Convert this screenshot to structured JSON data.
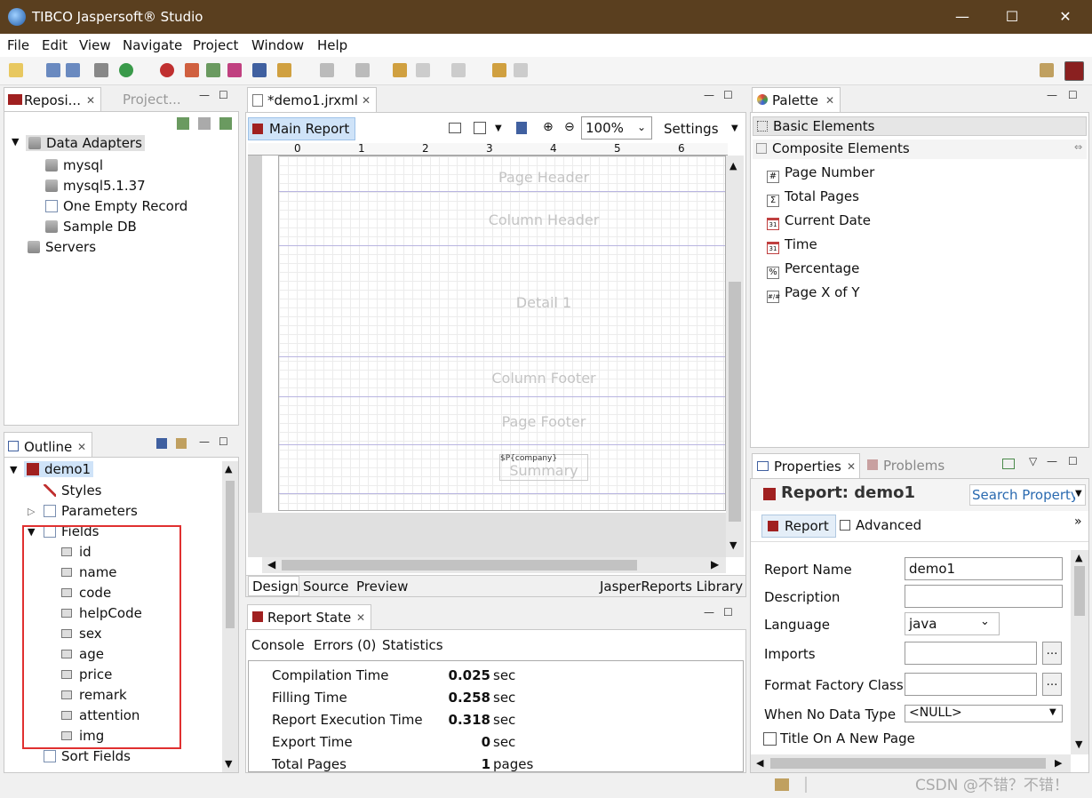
{
  "window": {
    "title": "TIBCO Jaspersoft® Studio",
    "minimize": "—",
    "maximize": "☐",
    "close": "✕"
  },
  "menu": [
    "File",
    "Edit",
    "View",
    "Navigate",
    "Project",
    "Window",
    "Help"
  ],
  "repository": {
    "tabs": [
      "Reposi...",
      "Project..."
    ],
    "tree": {
      "root": "Data Adapters",
      "items": [
        "mysql",
        "mysql5.1.37",
        "One Empty Record",
        "Sample DB"
      ],
      "servers": "Servers"
    }
  },
  "outline": {
    "tab": "Outline",
    "root": "demo1",
    "styles": "Styles",
    "parameters": "Parameters",
    "fields_label": "Fields",
    "fields": [
      "id",
      "name",
      "code",
      "helpCode",
      "sex",
      "age",
      "price",
      "remark",
      "attention",
      "img"
    ],
    "sort_fields": "Sort Fields"
  },
  "editor": {
    "tab": "*demo1.jrxml",
    "main_report": "Main Report",
    "zoom": "100%",
    "settings": "Settings",
    "ruler": [
      "0",
      "1",
      "2",
      "3",
      "4",
      "5",
      "6"
    ],
    "bands": [
      "Page Header",
      "Column Header",
      "Detail 1",
      "Column Footer",
      "Page Footer",
      "Summary"
    ],
    "summary_field": "$P{company}",
    "bottom_tabs": [
      "Design",
      "Source",
      "Preview"
    ],
    "library": "JasperReports Library"
  },
  "report_state": {
    "tab": "Report State",
    "subtabs": [
      "Console",
      "Errors (0)",
      "Statistics"
    ],
    "rows": [
      {
        "label": "Compilation Time",
        "value": "0.025",
        "unit": "sec"
      },
      {
        "label": "Filling Time",
        "value": "0.258",
        "unit": "sec"
      },
      {
        "label": "Report Execution Time",
        "value": "0.318",
        "unit": "sec"
      },
      {
        "label": "Export Time",
        "value": "0",
        "unit": "sec"
      },
      {
        "label": "Total Pages",
        "value": "1",
        "unit": "pages"
      }
    ]
  },
  "palette": {
    "tab": "Palette",
    "basic": "Basic Elements",
    "composite": "Composite Elements",
    "items": [
      {
        "label": "Page Number",
        "icon": "#"
      },
      {
        "label": "Total Pages",
        "icon": "Σ"
      },
      {
        "label": "Current Date",
        "icon": "31"
      },
      {
        "label": "Time",
        "icon": "31"
      },
      {
        "label": "Percentage",
        "icon": "%"
      },
      {
        "label": "Page X of Y",
        "icon": "#/#"
      }
    ]
  },
  "properties": {
    "tabs": [
      "Properties",
      "Problems"
    ],
    "title": "Report: demo1",
    "search": "Search Property",
    "subtabs": [
      "Report",
      "Advanced"
    ],
    "fields": {
      "report_name_label": "Report Name",
      "report_name": "demo1",
      "description_label": "Description",
      "description": "",
      "language_label": "Language",
      "language": "java",
      "imports_label": "Imports",
      "imports": "",
      "format_factory_label": "Format Factory Class",
      "format_factory": "",
      "no_data_label": "When No Data Type",
      "no_data": "<NULL>",
      "title_new_page": "Title On A New Page"
    }
  },
  "watermark": "CSDN @不错？不错！",
  "colors": {
    "titlebar": "#5a3f1f",
    "highlight_box": "#e03030",
    "band_line": "#b8b4e0"
  }
}
